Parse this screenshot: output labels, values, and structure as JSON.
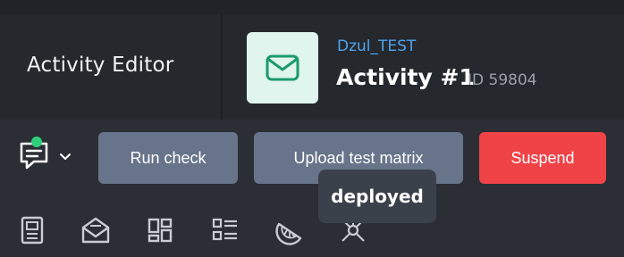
{
  "header": {
    "app_title": "Activity Editor",
    "project_name": "Dzul_TEST",
    "activity_name": "Activity #1",
    "activity_id": "ID 59804"
  },
  "toolbar": {
    "run_check_label": "Run check",
    "upload_label": "Upload test matrix",
    "suspend_label": "Suspend"
  },
  "tooltip": {
    "text": "deployed"
  },
  "icons": {
    "activity": "envelope-icon",
    "chat": "chat-icon",
    "tabs": [
      "document-icon",
      "mail-open-icon",
      "dashboard-icon",
      "list-icon",
      "citrus-icon",
      "network-icon"
    ]
  },
  "colors": {
    "accent_blue": "#4fa3ee",
    "danger": "#ef4348",
    "notification": "#2fcf7c",
    "icon_mint": "#dff5ee",
    "icon_green": "#1d9a6c",
    "button_gray": "#67748a"
  }
}
